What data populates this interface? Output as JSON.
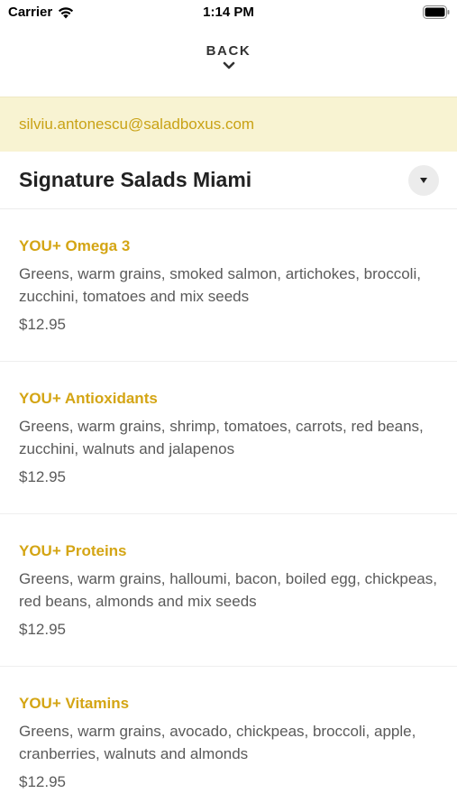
{
  "status_bar": {
    "carrier": "Carrier",
    "time": "1:14 PM"
  },
  "nav": {
    "back_label": "BACK"
  },
  "account": {
    "email": "silviu.antonescu@saladboxus.com"
  },
  "location": {
    "title": "Signature Salads Miami"
  },
  "menu": [
    {
      "name": "YOU+ Omega 3",
      "description": "Greens, warm grains, smoked salmon, artichokes, broccoli, zucchini, tomatoes and mix seeds",
      "price": "$12.95"
    },
    {
      "name": "YOU+ Antioxidants",
      "description": "Greens, warm grains, shrimp, tomatoes, carrots, red beans, zucchini, walnuts and jalapenos",
      "price": "$12.95"
    },
    {
      "name": "YOU+ Proteins",
      "description": "Greens, warm grains, halloumi, bacon, boiled egg, chickpeas, red beans, almonds and mix seeds",
      "price": "$12.95"
    },
    {
      "name": "YOU+ Vitamins",
      "description": "Greens, warm grains, avocado, chickpeas, broccoli, apple, cranberries, walnuts and almonds",
      "price": "$12.95"
    }
  ],
  "icons": {
    "wifi": "wifi-icon",
    "battery": "battery-icon",
    "back": "chevron-down-icon",
    "dropdown": "caret-down-icon"
  },
  "colors": {
    "accent": "#d4a514",
    "banner_background": "#f8f3d2",
    "email_text": "#c9a215"
  }
}
